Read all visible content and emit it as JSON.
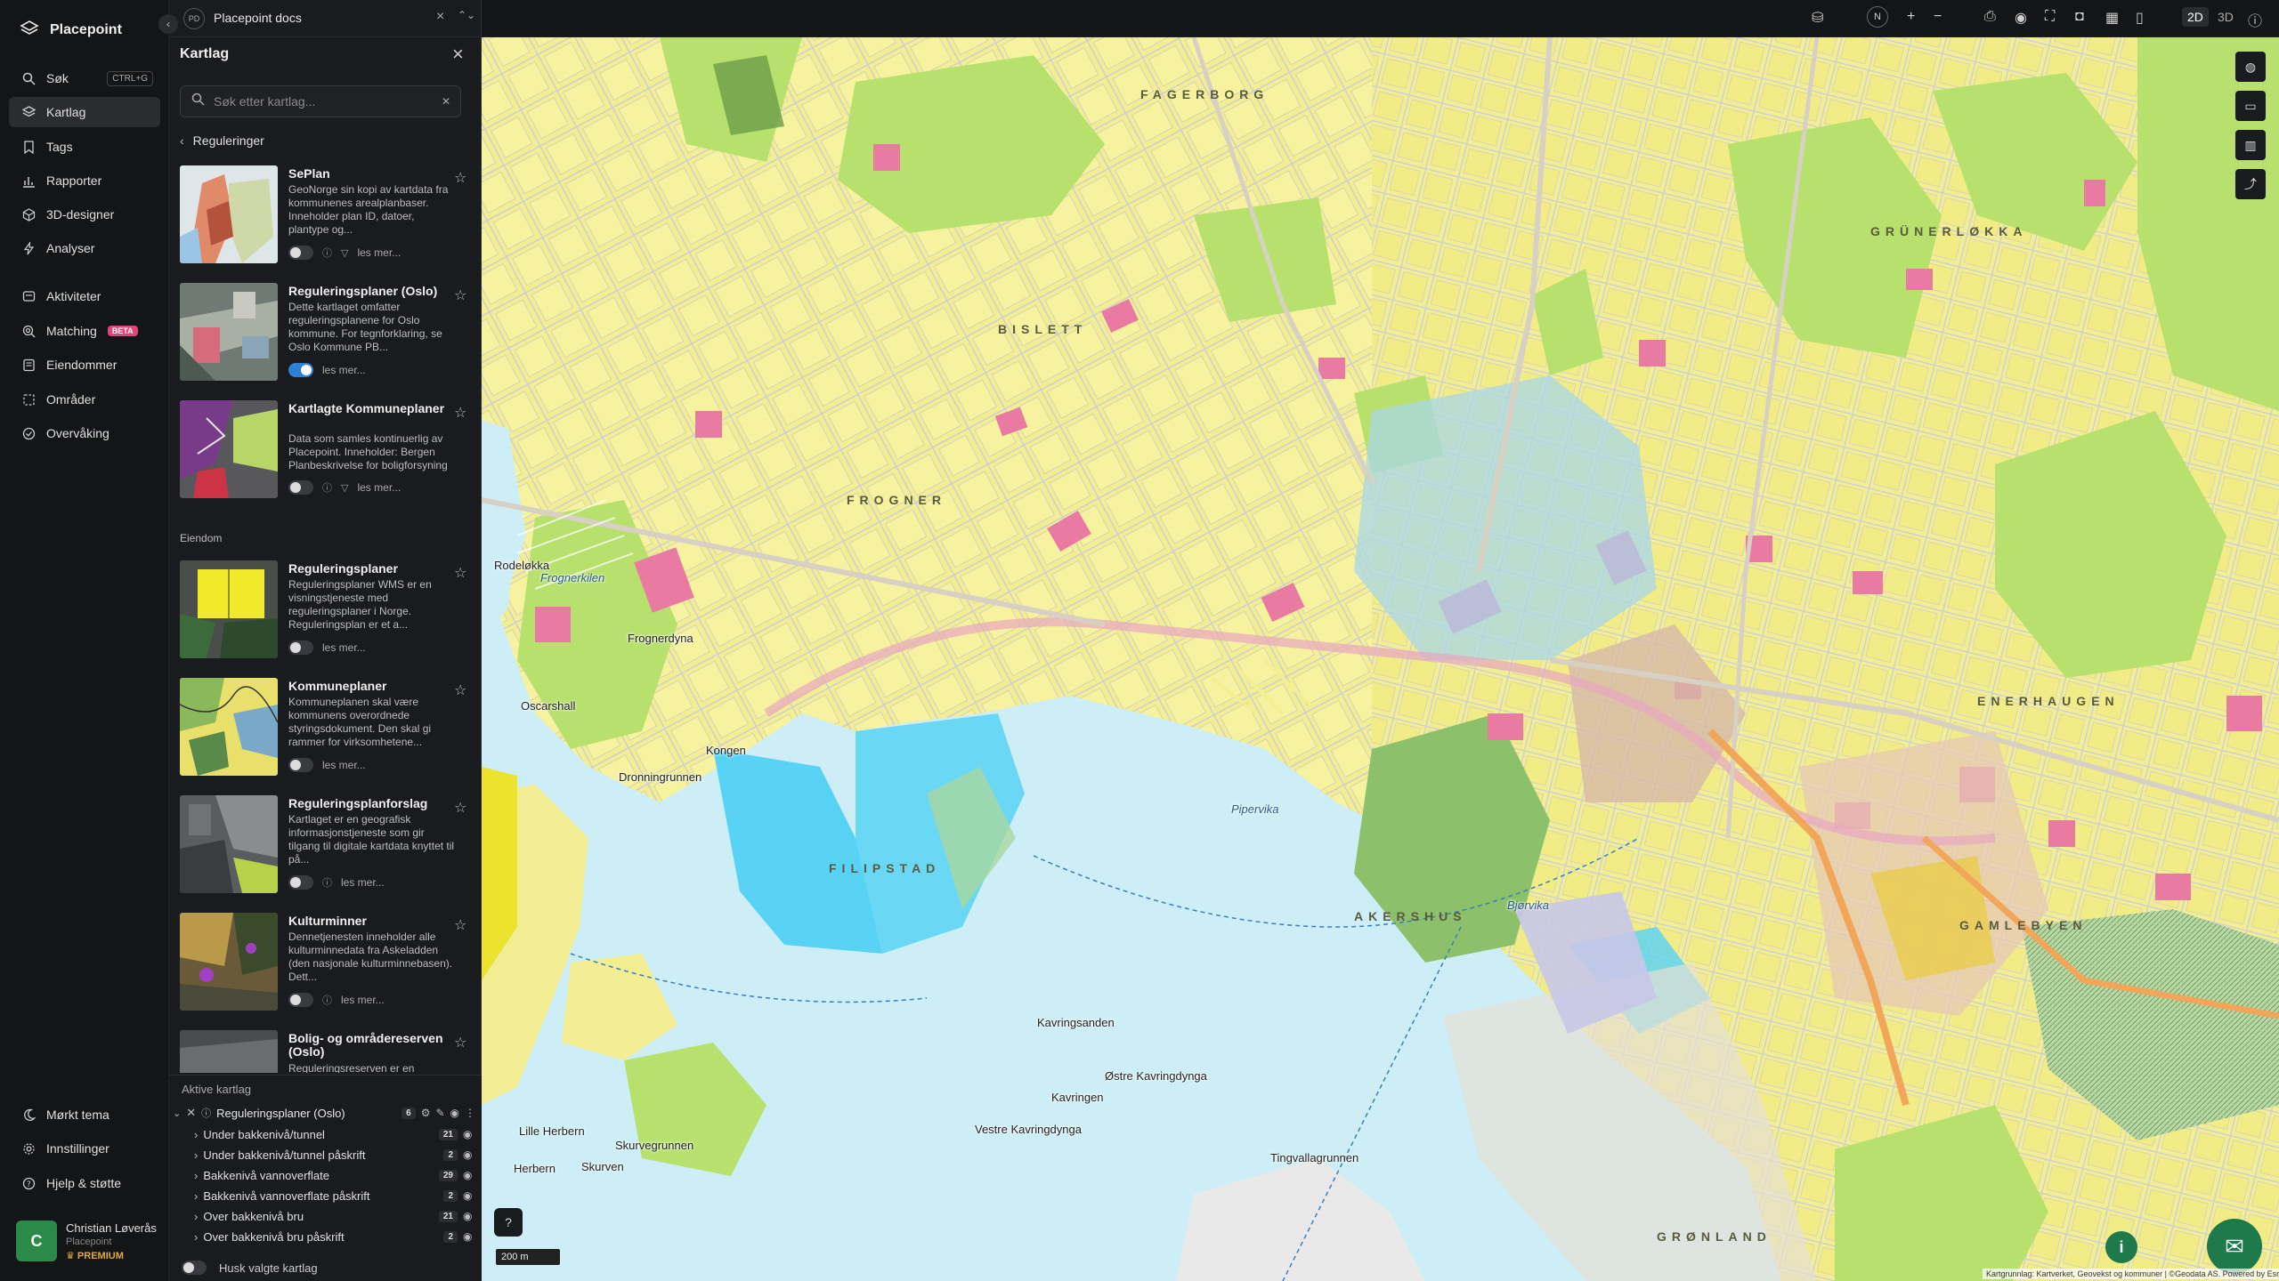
{
  "app": {
    "name": "Placepoint",
    "collapse_icon": "chevron-left-icon"
  },
  "nav": {
    "items": [
      {
        "label": "Søk",
        "icon": "search-icon",
        "shortcut": "CTRL+G"
      },
      {
        "label": "Kartlag",
        "icon": "layers-icon",
        "active": true
      },
      {
        "label": "Tags",
        "icon": "bookmark-icon"
      },
      {
        "label": "Rapporter",
        "icon": "bar-chart-icon"
      },
      {
        "label": "3D-designer",
        "icon": "cube-icon"
      },
      {
        "label": "Analyser",
        "icon": "lightning-icon"
      },
      {
        "label": "Aktiviteter",
        "icon": "stack-icon"
      },
      {
        "label": "Matching",
        "icon": "target-icon",
        "badge": "BETA"
      },
      {
        "label": "Eiendommer",
        "icon": "document-icon"
      },
      {
        "label": "Områder",
        "icon": "area-icon"
      },
      {
        "label": "Overvåking",
        "icon": "check-circle-icon"
      },
      {
        "label": "Mørkt tema",
        "icon": "moon-icon"
      },
      {
        "label": "Innstillinger",
        "icon": "gear-icon"
      },
      {
        "label": "Hjelp & støtte",
        "icon": "help-icon"
      }
    ],
    "user": {
      "initial": "C",
      "name": "Christian Løverås",
      "org": "Placepoint",
      "plan": "PREMIUM"
    }
  },
  "panel": {
    "doc_badge": "PD",
    "doc_title": "Placepoint docs",
    "title": "Kartlag",
    "search_placeholder": "Søk etter kartlag...",
    "breadcrumb": "Reguleringer",
    "section_eiendom": "Eiendom",
    "read_more": "les mer...",
    "cards": [
      {
        "title": "SePlan",
        "desc": "GeoNorge sin kopi av kartdata fra kommunenes arealplanbaser. Inneholder plan ID, datoer, plantype og...",
        "on": false
      },
      {
        "title": "Reguleringsplaner (Oslo)",
        "desc": "Dette kartlaget omfatter reguleringsplanene for Oslo kommune. For tegnforklaring, se Oslo Kommune PB...",
        "on": true
      },
      {
        "title": "Kartlagte Kommuneplaner",
        "desc": "Data som samles kontinuerlig av Placepoint. Inneholder: Bergen Planbeskrivelse for boligforsyning ...",
        "on": false
      },
      {
        "title": "Reguleringsplaner",
        "desc": "Reguleringsplaner WMS er en visningstjeneste med reguleringsplaner i Norge. Reguleringsplan er et a...",
        "on": false
      },
      {
        "title": "Kommuneplaner",
        "desc": "Kommuneplanen skal være kommunens overordnede styringsdokument. Den skal gi rammer for virksomhetene...",
        "on": false
      },
      {
        "title": "Reguleringsplanforslag",
        "desc": "Kartlaget er en geografisk informasjonstjeneste som gir tilgang til digitale kartdata knyttet til på...",
        "on": false
      },
      {
        "title": "Kulturminner",
        "desc": "Dennetjenesten inneholder alle kulturminnedata fra Askeladden (den nasjonale kulturminnebasen). Dett...",
        "on": false
      },
      {
        "title": "Bolig- og områdereserven (Oslo)",
        "desc": "Reguleringsreserven er en",
        "on": false
      }
    ],
    "active": {
      "label": "Aktive kartlag",
      "root": {
        "name": "Reguleringsplaner (Oslo)",
        "count": "6"
      },
      "rows": [
        {
          "name": "Under bakkenivå/tunnel",
          "count": "21"
        },
        {
          "name": "Under bakkenivå/tunnel påskrift",
          "count": "2"
        },
        {
          "name": "Bakkenivå vannoverflate",
          "count": "29"
        },
        {
          "name": "Bakkenivå vannoverflate påskrift",
          "count": "2"
        },
        {
          "name": "Over bakkenivå bru",
          "count": "21"
        },
        {
          "name": "Over bakkenivå bru påskrift",
          "count": "2"
        }
      ],
      "remember": "Husk valgte kartlag"
    }
  },
  "topbar": {
    "mode_2d": "2D",
    "mode_3d": "3D",
    "compass": "N"
  },
  "map": {
    "scale": "200 m",
    "attribution": "Kartgrunnlag: Kartverket, Geovekst og kommuner | ©Geodata AS. Powered by Esri",
    "labels": [
      {
        "text": "FAGERBORG",
        "type": "district"
      },
      {
        "text": "BISLETT",
        "type": "district"
      },
      {
        "text": "GRÜNERLØKKA",
        "type": "district"
      },
      {
        "text": "FROGNER",
        "type": "district"
      },
      {
        "text": "FILIPSTAD",
        "type": "district"
      },
      {
        "text": "AKERSHUS",
        "type": "district"
      },
      {
        "text": "GAMLEBYEN",
        "type": "district"
      },
      {
        "text": "GRØNLAND",
        "type": "district"
      },
      {
        "text": "ENERHAUGEN",
        "type": "district"
      },
      {
        "text": "Frognerkilen",
        "type": "water"
      },
      {
        "text": "Pipervika",
        "type": "water"
      },
      {
        "text": "Bjørvika",
        "type": "water"
      },
      {
        "text": "Frognerdyna",
        "type": "place"
      },
      {
        "text": "Oscarshall",
        "type": "place"
      },
      {
        "text": "Dronningrunnen",
        "type": "place"
      },
      {
        "text": "Kongen",
        "type": "place"
      },
      {
        "text": "Kavringsanden",
        "type": "place"
      },
      {
        "text": "Østre Kavringdynga",
        "type": "place"
      },
      {
        "text": "Kavringen",
        "type": "place"
      },
      {
        "text": "Vestre Kavringdynga",
        "type": "place"
      },
      {
        "text": "Tingvallagrunnen",
        "type": "place"
      },
      {
        "text": "Lille Herbern",
        "type": "place"
      },
      {
        "text": "Herbern",
        "type": "place"
      },
      {
        "text": "Skurven",
        "type": "place"
      },
      {
        "text": "Skurvegrunnen",
        "type": "place"
      },
      {
        "text": "Rodeløkka",
        "type": "place"
      }
    ]
  }
}
